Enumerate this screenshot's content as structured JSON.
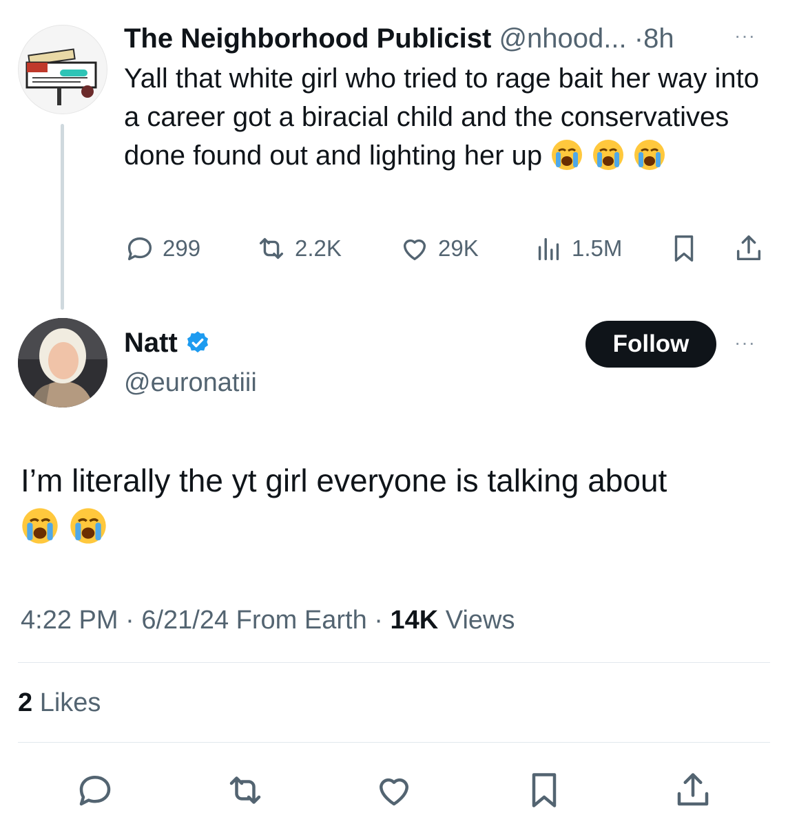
{
  "thread_parent": {
    "author_name": "The Neighborhood Publicist",
    "author_handle": "@nhood...",
    "separator": "·",
    "time_ago": "8h",
    "more_label": "···",
    "text": "Yall that white girl who tried to rage bait her way into a career got a biracial child and the conservatives done found out and lighting her up",
    "emojis": [
      "loudly-crying-face",
      "loudly-crying-face",
      "loudly-crying-face"
    ],
    "stats": {
      "replies": "299",
      "reposts": "2.2K",
      "likes": "29K",
      "views": "1.5M"
    }
  },
  "tweet": {
    "author_name": "Natt",
    "verified": true,
    "author_handle": "@euronatiii",
    "follow_label": "Follow",
    "more_label": "···",
    "text": "I’m literally the yt girl everyone is talking about",
    "emojis": [
      "loudly-crying-face",
      "loudly-crying-face"
    ],
    "time": "4:22 PM",
    "date": "6/21/24",
    "location": "From Earth",
    "views_count": "14K",
    "views_label": "Views",
    "likes_count": "2",
    "likes_label": "Likes"
  },
  "colors": {
    "text_primary": "#0f1419",
    "text_secondary": "#536471",
    "verified_blue": "#1d9bf0",
    "follow_bg": "#0f1419",
    "emoji_yellow": "#ffc83d",
    "tear_blue": "#4fa8e8"
  }
}
